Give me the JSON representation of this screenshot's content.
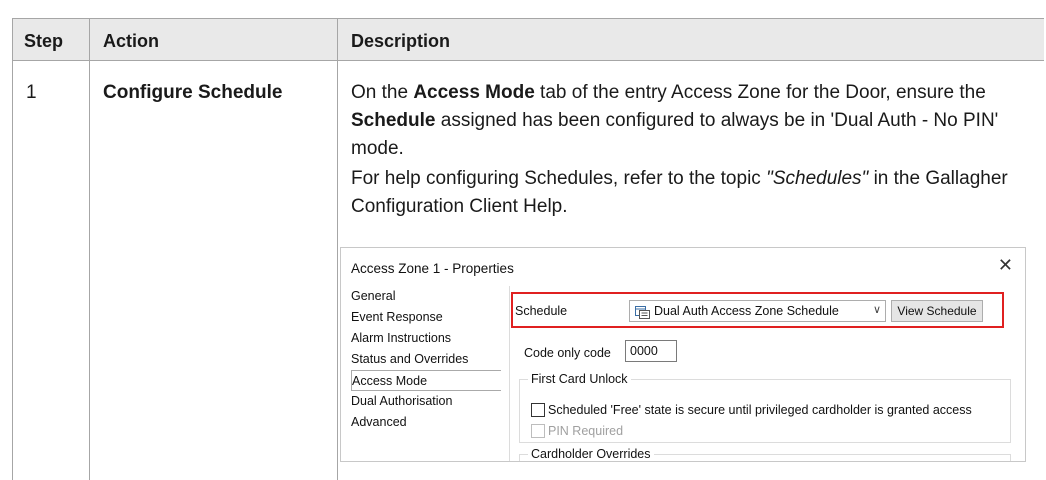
{
  "table": {
    "headers": [
      "Step",
      "Action",
      "Description"
    ],
    "row": {
      "step": "1",
      "action": "Configure Schedule",
      "desc_p1": {
        "t1": "On the ",
        "b1": "Access Mode",
        "t2": " tab of the entry Access Zone for the Door, ensure the ",
        "b2": "Schedule",
        "t3": " assigned has been configured to always be in 'Dual Auth - No PIN' mode."
      },
      "desc_p2": {
        "t1": "For help configuring Schedules, refer to the topic ",
        "i1": "\"Schedules\"",
        "t2": " in the Gallagher Configuration Client Help."
      }
    }
  },
  "dialog": {
    "title": "Access Zone 1 - Properties",
    "close_glyph": "✕",
    "nav_items": [
      "General",
      "Event Response",
      "Alarm Instructions",
      "Status and Overrides",
      "Access Mode",
      "Dual Authorisation",
      "Advanced"
    ],
    "selected_nav": "Access Mode",
    "schedule_label": "Schedule",
    "schedule_value": "Dual Auth Access Zone Schedule",
    "schedule_icon": "schedule-calendar-icon",
    "view_schedule_button": "View Schedule",
    "code_only_label": "Code only code",
    "code_only_value": "0000",
    "first_card_unlock_legend": "First Card Unlock",
    "checkbox_secure_label": "Scheduled 'Free' state is secure until privileged cardholder is granted access",
    "checkbox_secure_checked": false,
    "checkbox_pin_label": "PIN Required",
    "checkbox_pin_checked": false,
    "cardholder_overrides_legend": "Cardholder Overrides",
    "highlight_color": "#e02020"
  }
}
